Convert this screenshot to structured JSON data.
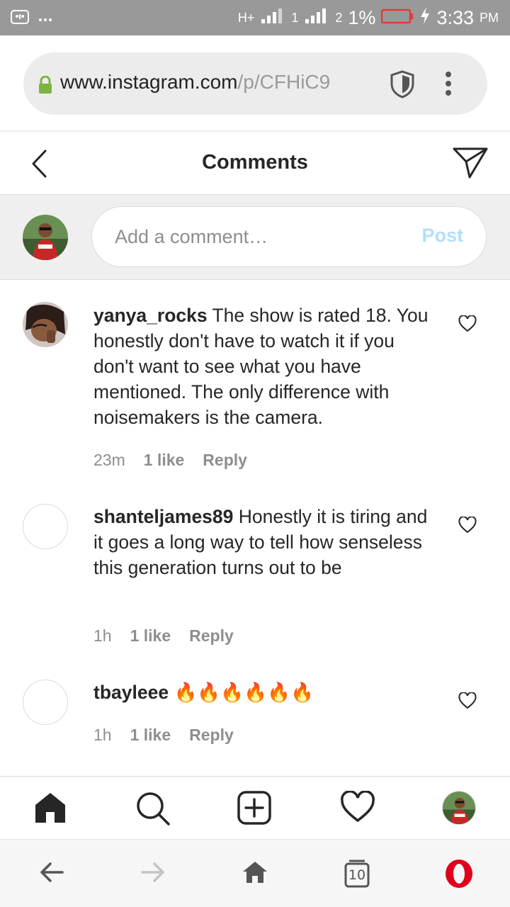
{
  "status_bar": {
    "network_1": "H+",
    "network_2": "H+",
    "sim_1": "1",
    "sim_2": "2",
    "battery": "1%",
    "time": "3:33",
    "ampm": "PM",
    "icons": [
      "screenshot-icon",
      "more-dots-icon",
      "signal-icon",
      "battery-icon",
      "charging-icon"
    ]
  },
  "browser": {
    "url_host": "www.instagram.com",
    "url_path": "/p/CFHiC9",
    "tab_count": "10"
  },
  "header": {
    "title": "Comments"
  },
  "add_comment": {
    "placeholder": "Add a comment…",
    "post_label": "Post"
  },
  "comments": [
    {
      "username": "yanya_rocks",
      "text": " The show is rated 18. You honestly don't have to watch it if you don't want to see what you have mentioned. The only difference with noisemakers is the camera.",
      "time": "23m",
      "likes": "1 like",
      "reply": "Reply"
    },
    {
      "username": "shanteljames89",
      "text": " Honestly it is tiring and it goes a long way to tell how senseless this generation turns out to be",
      "time": "1h",
      "likes": "1 like",
      "reply": "Reply"
    },
    {
      "username": "tbayleee",
      "text": " 🔥🔥🔥🔥🔥🔥",
      "time": "1h",
      "likes": "1 like",
      "reply": "Reply"
    }
  ],
  "colors": {
    "post_disabled": "#b2dffc",
    "meta_gray": "#8e8e8e",
    "lock_green": "#7cb342",
    "opera_red": "#e0001b"
  }
}
